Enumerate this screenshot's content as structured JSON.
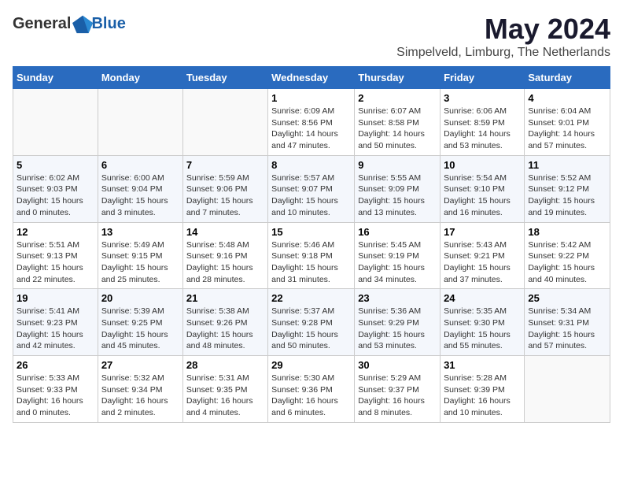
{
  "logo": {
    "text_general": "General",
    "text_blue": "Blue"
  },
  "header": {
    "month": "May 2024",
    "location": "Simpelveld, Limburg, The Netherlands"
  },
  "days_of_week": [
    "Sunday",
    "Monday",
    "Tuesday",
    "Wednesday",
    "Thursday",
    "Friday",
    "Saturday"
  ],
  "weeks": [
    [
      {
        "day": "",
        "info": ""
      },
      {
        "day": "",
        "info": ""
      },
      {
        "day": "",
        "info": ""
      },
      {
        "day": "1",
        "info": "Sunrise: 6:09 AM\nSunset: 8:56 PM\nDaylight: 14 hours\nand 47 minutes."
      },
      {
        "day": "2",
        "info": "Sunrise: 6:07 AM\nSunset: 8:58 PM\nDaylight: 14 hours\nand 50 minutes."
      },
      {
        "day": "3",
        "info": "Sunrise: 6:06 AM\nSunset: 8:59 PM\nDaylight: 14 hours\nand 53 minutes."
      },
      {
        "day": "4",
        "info": "Sunrise: 6:04 AM\nSunset: 9:01 PM\nDaylight: 14 hours\nand 57 minutes."
      }
    ],
    [
      {
        "day": "5",
        "info": "Sunrise: 6:02 AM\nSunset: 9:03 PM\nDaylight: 15 hours\nand 0 minutes."
      },
      {
        "day": "6",
        "info": "Sunrise: 6:00 AM\nSunset: 9:04 PM\nDaylight: 15 hours\nand 3 minutes."
      },
      {
        "day": "7",
        "info": "Sunrise: 5:59 AM\nSunset: 9:06 PM\nDaylight: 15 hours\nand 7 minutes."
      },
      {
        "day": "8",
        "info": "Sunrise: 5:57 AM\nSunset: 9:07 PM\nDaylight: 15 hours\nand 10 minutes."
      },
      {
        "day": "9",
        "info": "Sunrise: 5:55 AM\nSunset: 9:09 PM\nDaylight: 15 hours\nand 13 minutes."
      },
      {
        "day": "10",
        "info": "Sunrise: 5:54 AM\nSunset: 9:10 PM\nDaylight: 15 hours\nand 16 minutes."
      },
      {
        "day": "11",
        "info": "Sunrise: 5:52 AM\nSunset: 9:12 PM\nDaylight: 15 hours\nand 19 minutes."
      }
    ],
    [
      {
        "day": "12",
        "info": "Sunrise: 5:51 AM\nSunset: 9:13 PM\nDaylight: 15 hours\nand 22 minutes."
      },
      {
        "day": "13",
        "info": "Sunrise: 5:49 AM\nSunset: 9:15 PM\nDaylight: 15 hours\nand 25 minutes."
      },
      {
        "day": "14",
        "info": "Sunrise: 5:48 AM\nSunset: 9:16 PM\nDaylight: 15 hours\nand 28 minutes."
      },
      {
        "day": "15",
        "info": "Sunrise: 5:46 AM\nSunset: 9:18 PM\nDaylight: 15 hours\nand 31 minutes."
      },
      {
        "day": "16",
        "info": "Sunrise: 5:45 AM\nSunset: 9:19 PM\nDaylight: 15 hours\nand 34 minutes."
      },
      {
        "day": "17",
        "info": "Sunrise: 5:43 AM\nSunset: 9:21 PM\nDaylight: 15 hours\nand 37 minutes."
      },
      {
        "day": "18",
        "info": "Sunrise: 5:42 AM\nSunset: 9:22 PM\nDaylight: 15 hours\nand 40 minutes."
      }
    ],
    [
      {
        "day": "19",
        "info": "Sunrise: 5:41 AM\nSunset: 9:23 PM\nDaylight: 15 hours\nand 42 minutes."
      },
      {
        "day": "20",
        "info": "Sunrise: 5:39 AM\nSunset: 9:25 PM\nDaylight: 15 hours\nand 45 minutes."
      },
      {
        "day": "21",
        "info": "Sunrise: 5:38 AM\nSunset: 9:26 PM\nDaylight: 15 hours\nand 48 minutes."
      },
      {
        "day": "22",
        "info": "Sunrise: 5:37 AM\nSunset: 9:28 PM\nDaylight: 15 hours\nand 50 minutes."
      },
      {
        "day": "23",
        "info": "Sunrise: 5:36 AM\nSunset: 9:29 PM\nDaylight: 15 hours\nand 53 minutes."
      },
      {
        "day": "24",
        "info": "Sunrise: 5:35 AM\nSunset: 9:30 PM\nDaylight: 15 hours\nand 55 minutes."
      },
      {
        "day": "25",
        "info": "Sunrise: 5:34 AM\nSunset: 9:31 PM\nDaylight: 15 hours\nand 57 minutes."
      }
    ],
    [
      {
        "day": "26",
        "info": "Sunrise: 5:33 AM\nSunset: 9:33 PM\nDaylight: 16 hours\nand 0 minutes."
      },
      {
        "day": "27",
        "info": "Sunrise: 5:32 AM\nSunset: 9:34 PM\nDaylight: 16 hours\nand 2 minutes."
      },
      {
        "day": "28",
        "info": "Sunrise: 5:31 AM\nSunset: 9:35 PM\nDaylight: 16 hours\nand 4 minutes."
      },
      {
        "day": "29",
        "info": "Sunrise: 5:30 AM\nSunset: 9:36 PM\nDaylight: 16 hours\nand 6 minutes."
      },
      {
        "day": "30",
        "info": "Sunrise: 5:29 AM\nSunset: 9:37 PM\nDaylight: 16 hours\nand 8 minutes."
      },
      {
        "day": "31",
        "info": "Sunrise: 5:28 AM\nSunset: 9:39 PM\nDaylight: 16 hours\nand 10 minutes."
      },
      {
        "day": "",
        "info": ""
      }
    ]
  ]
}
